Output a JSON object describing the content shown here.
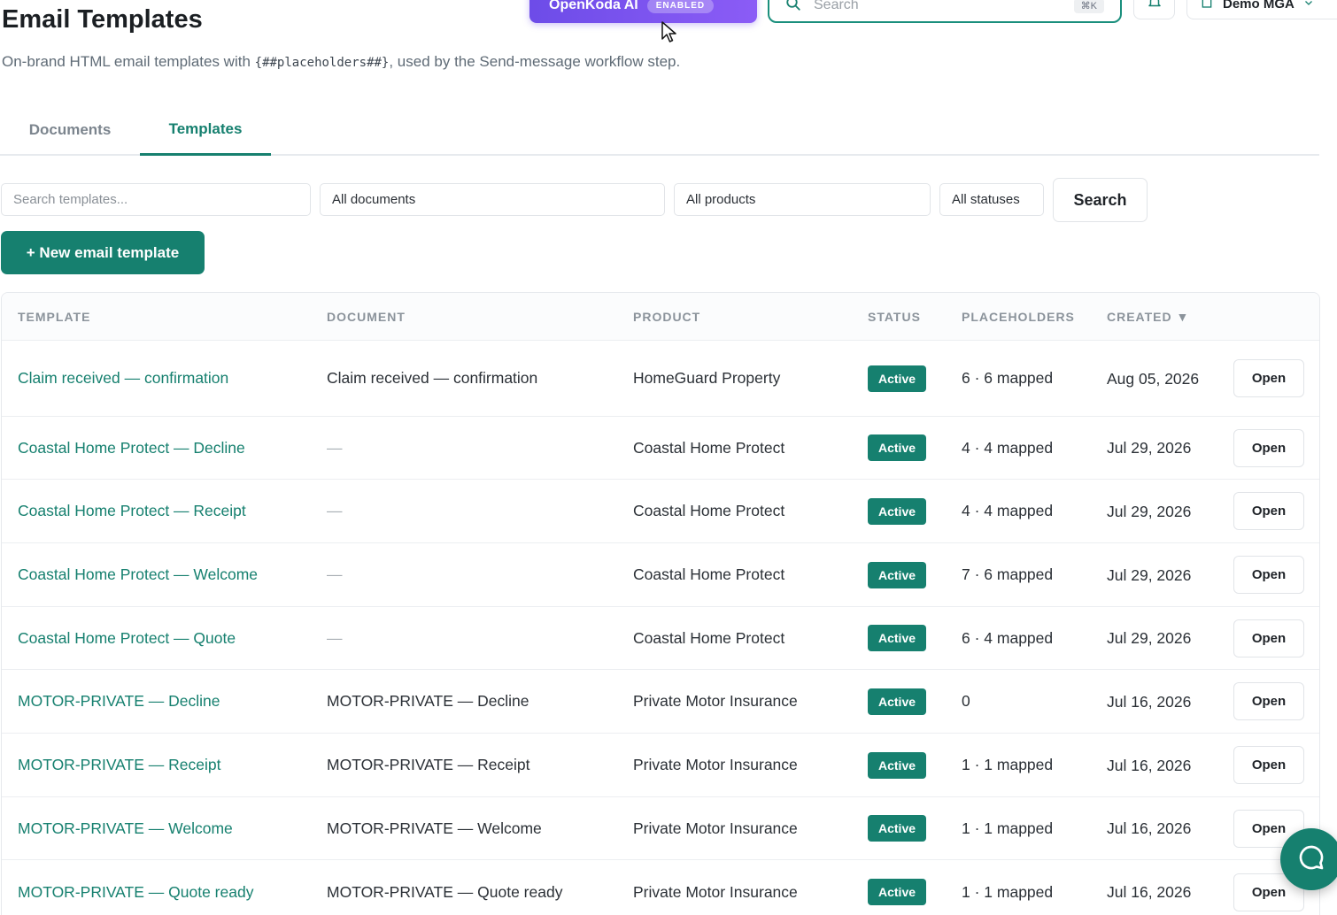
{
  "topbar": {
    "ai_label": "OpenKoda AI",
    "ai_badge": "ENABLED",
    "search_placeholder": "Search",
    "search_shortcut": "⌘K",
    "org_name": "Demo MGA"
  },
  "header": {
    "title": "Email Templates",
    "subtitle_prefix": "On-brand HTML email templates with ",
    "subtitle_code": "{##placeholders##}",
    "subtitle_suffix": ", used by the Send-message workflow step."
  },
  "tabs": [
    {
      "label": "Documents",
      "active": false
    },
    {
      "label": "Templates",
      "active": true
    }
  ],
  "filters": {
    "search_placeholder": "Search templates...",
    "document": "All documents",
    "product": "All products",
    "status": "All statuses",
    "search_button": "Search"
  },
  "new_button": "+ New email template",
  "table": {
    "columns": [
      "TEMPLATE",
      "DOCUMENT",
      "PRODUCT",
      "STATUS",
      "PLACEHOLDERS",
      "CREATED ▼"
    ],
    "open_label": "Open",
    "rows": [
      {
        "template": "Claim received — confirmation",
        "document": "Claim received — confirmation",
        "product": "HomeGuard Property",
        "status": "Active",
        "placeholders": "6 · 6 mapped",
        "created": "Aug 05, 2026"
      },
      {
        "template": "Coastal Home Protect — Decline",
        "document": "—",
        "product": "Coastal Home Protect",
        "status": "Active",
        "placeholders": "4 · 4 mapped",
        "created": "Jul 29, 2026"
      },
      {
        "template": "Coastal Home Protect — Receipt",
        "document": "—",
        "product": "Coastal Home Protect",
        "status": "Active",
        "placeholders": "4 · 4 mapped",
        "created": "Jul 29, 2026"
      },
      {
        "template": "Coastal Home Protect — Welcome",
        "document": "—",
        "product": "Coastal Home Protect",
        "status": "Active",
        "placeholders": "7 · 6 mapped",
        "created": "Jul 29, 2026"
      },
      {
        "template": "Coastal Home Protect — Quote",
        "document": "—",
        "product": "Coastal Home Protect",
        "status": "Active",
        "placeholders": "6 · 4 mapped",
        "created": "Jul 29, 2026"
      },
      {
        "template": "MOTOR-PRIVATE — Decline",
        "document": "MOTOR-PRIVATE — Decline",
        "product": "Private Motor Insurance",
        "status": "Active",
        "placeholders": "0",
        "created": "Jul 16, 2026"
      },
      {
        "template": "MOTOR-PRIVATE — Receipt",
        "document": "MOTOR-PRIVATE — Receipt",
        "product": "Private Motor Insurance",
        "status": "Active",
        "placeholders": "1 · 1 mapped",
        "created": "Jul 16, 2026"
      },
      {
        "template": "MOTOR-PRIVATE — Welcome",
        "document": "MOTOR-PRIVATE — Welcome",
        "product": "Private Motor Insurance",
        "status": "Active",
        "placeholders": "1 · 1 mapped",
        "created": "Jul 16, 2026"
      },
      {
        "template": "MOTOR-PRIVATE — Quote ready",
        "document": "MOTOR-PRIVATE — Quote ready",
        "product": "Private Motor Insurance",
        "status": "Active",
        "placeholders": "1 · 1 mapped",
        "created": "Jul 16, 2026"
      }
    ]
  },
  "colors": {
    "accent": "#16806f",
    "ai_purple": "#7c4dea"
  },
  "icons": [
    "search-icon",
    "bell-icon",
    "building-icon",
    "chevron-down-icon",
    "cursor-icon",
    "chat-icon"
  ]
}
